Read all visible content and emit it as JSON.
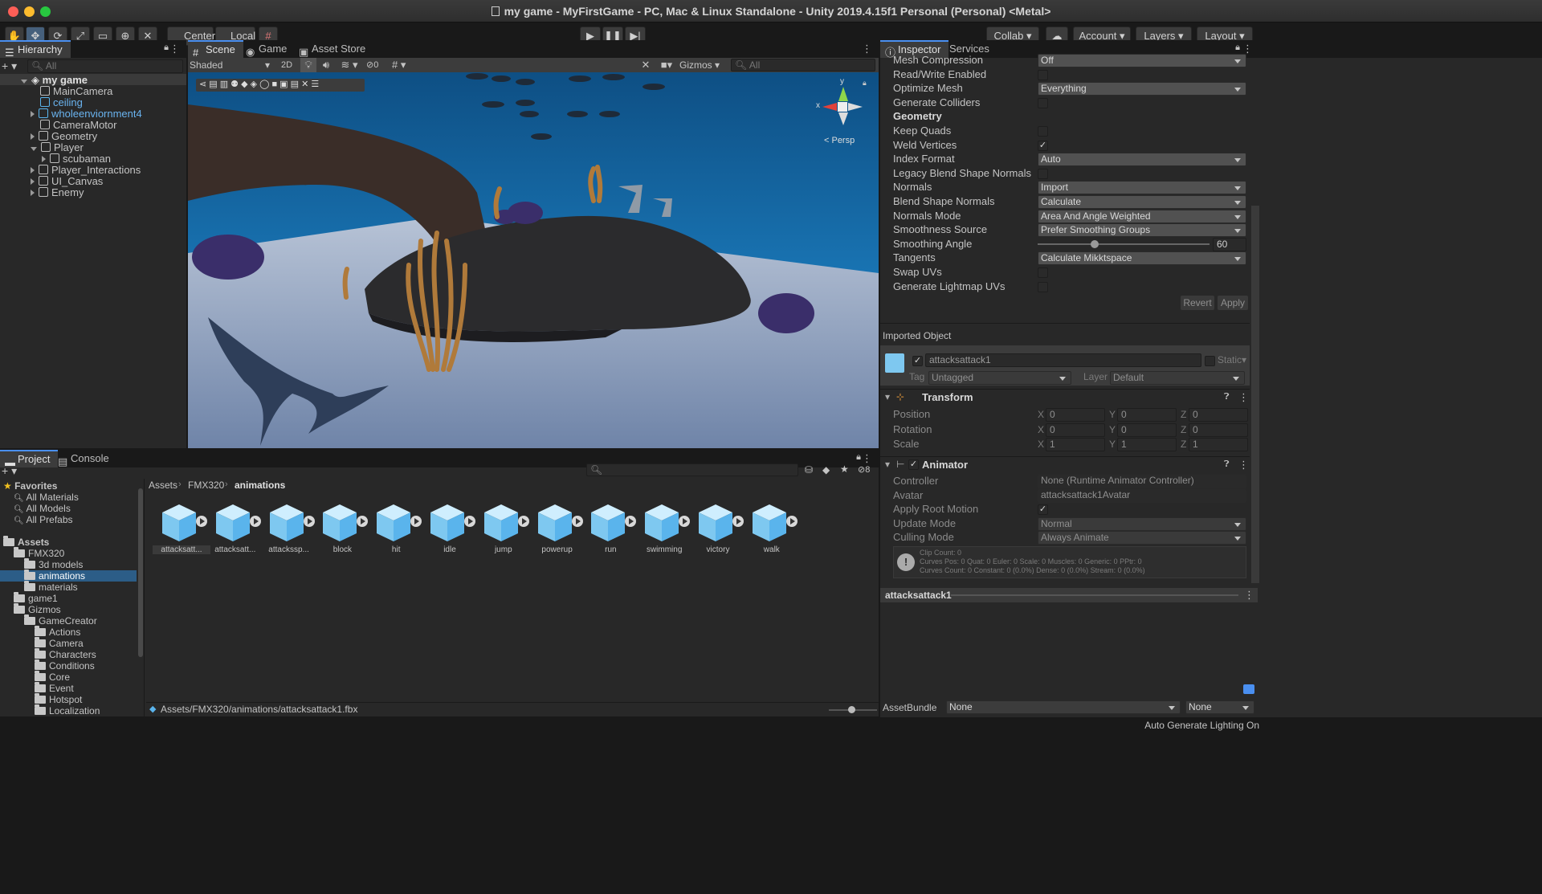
{
  "window": {
    "title": "my game - MyFirstGame - PC, Mac & Linux Standalone - Unity 2019.4.15f1 Personal (Personal) <Metal>"
  },
  "toolbar": {
    "center": "Center",
    "local": "Local",
    "collab": "Collab",
    "account": "Account",
    "layers": "Layers",
    "layout": "Layout"
  },
  "hierarchy": {
    "tab": "Hierarchy",
    "search": "All",
    "scene": "my game",
    "items": [
      "MainCamera",
      "ceiling",
      "wholeenviornment4",
      "CameraMotor",
      "Geometry",
      "Player",
      "scubaman",
      "Player_Interactions",
      "UI_Canvas",
      "Enemy"
    ]
  },
  "scene": {
    "tabs": [
      "Scene",
      "Game",
      "Asset Store"
    ],
    "shading": "Shaded",
    "mode2d": "2D",
    "gizmos": "Gizmos",
    "search": "All",
    "persp": "< Persp",
    "hidden_count": "0",
    "axis_x": "x",
    "axis_y": "y"
  },
  "project": {
    "tabs": [
      "Project",
      "Console"
    ],
    "hidden_count": "8",
    "tree": [
      {
        "label": "Favorites",
        "level": 0,
        "kind": "fav"
      },
      {
        "label": "All Materials",
        "level": 1,
        "kind": "search"
      },
      {
        "label": "All Models",
        "level": 1,
        "kind": "search"
      },
      {
        "label": "All Prefabs",
        "level": 1,
        "kind": "search"
      },
      {
        "label": "Assets",
        "level": 0,
        "kind": "folder"
      },
      {
        "label": "FMX320",
        "level": 1,
        "kind": "folder"
      },
      {
        "label": "3d models",
        "level": 2,
        "kind": "folder"
      },
      {
        "label": "animations",
        "level": 2,
        "kind": "folder"
      },
      {
        "label": "materials",
        "level": 2,
        "kind": "folder"
      },
      {
        "label": "game1",
        "level": 1,
        "kind": "folder"
      },
      {
        "label": "Gizmos",
        "level": 1,
        "kind": "folder"
      },
      {
        "label": "GameCreator",
        "level": 2,
        "kind": "folder"
      },
      {
        "label": "Actions",
        "level": 3,
        "kind": "folder"
      },
      {
        "label": "Camera",
        "level": 3,
        "kind": "folder"
      },
      {
        "label": "Characters",
        "level": 3,
        "kind": "folder"
      },
      {
        "label": "Conditions",
        "level": 3,
        "kind": "folder"
      },
      {
        "label": "Core",
        "level": 3,
        "kind": "folder"
      },
      {
        "label": "Event",
        "level": 3,
        "kind": "folder"
      },
      {
        "label": "Hotspot",
        "level": 3,
        "kind": "folder"
      },
      {
        "label": "Localization",
        "level": 3,
        "kind": "folder"
      }
    ],
    "breadcrumb": [
      "Assets",
      "FMX320",
      "animations"
    ],
    "assets": [
      "attacksatt...",
      "attacksatt...",
      "attackssp...",
      "block",
      "hit",
      "idle",
      "jump",
      "powerup",
      "run",
      "swimming",
      "victory",
      "walk"
    ],
    "footer_path": "Assets/FMX320/animations/attacksattack1.fbx"
  },
  "inspector": {
    "tabs": [
      "Inspector",
      "Services"
    ],
    "rows": [
      {
        "label": "Mesh Compression",
        "type": "dd",
        "value": "Off"
      },
      {
        "label": "Read/Write Enabled",
        "type": "chk",
        "value": ""
      },
      {
        "label": "Optimize Mesh",
        "type": "dd",
        "value": "Everything"
      },
      {
        "label": "Generate Colliders",
        "type": "chk",
        "value": ""
      },
      {
        "label": "Geometry",
        "type": "hdr",
        "value": ""
      },
      {
        "label": "Keep Quads",
        "type": "chk",
        "value": ""
      },
      {
        "label": "Weld Vertices",
        "type": "chk",
        "value": "✓"
      },
      {
        "label": "Index Format",
        "type": "dd",
        "value": "Auto"
      },
      {
        "label": "Legacy Blend Shape Normals",
        "type": "chk",
        "value": ""
      },
      {
        "label": "Normals",
        "type": "dd",
        "value": "Import"
      },
      {
        "label": "Blend Shape Normals",
        "type": "dd",
        "value": "Calculate"
      },
      {
        "label": "Normals Mode",
        "type": "dd",
        "value": "Area And Angle Weighted"
      },
      {
        "label": "Smoothness Source",
        "type": "dd",
        "value": "Prefer Smoothing Groups"
      },
      {
        "label": "Smoothing Angle",
        "type": "slider",
        "value": "60"
      },
      {
        "label": "Tangents",
        "type": "dd",
        "value": "Calculate Mikktspace"
      },
      {
        "label": "Swap UVs",
        "type": "chk",
        "value": ""
      },
      {
        "label": "Generate Lightmap UVs",
        "type": "chk",
        "value": ""
      }
    ],
    "slider_fraction": 0.33,
    "revert": "Revert",
    "apply": "Apply",
    "imported_object": "Imported Object",
    "object_name": "attacksattack1",
    "static": "Static",
    "tag_label": "Tag",
    "tag_value": "Untagged",
    "layer_label": "Layer",
    "layer_value": "Default",
    "transform": {
      "title": "Transform",
      "position": "Position",
      "rotation": "Rotation",
      "scale": "Scale",
      "pos": [
        "0",
        "0",
        "0"
      ],
      "rot": [
        "0",
        "0",
        "0"
      ],
      "scl": [
        "1",
        "1",
        "1"
      ],
      "axes": [
        "X",
        "Y",
        "Z"
      ]
    },
    "animator": {
      "title": "Animator",
      "rows": [
        {
          "label": "Controller",
          "value": "None (Runtime Animator Controller)"
        },
        {
          "label": "Avatar",
          "value": "attacksattack1Avatar"
        },
        {
          "label": "Apply Root Motion",
          "value": "✓"
        },
        {
          "label": "Update Mode",
          "value": "Normal"
        },
        {
          "label": "Culling Mode",
          "value": "Always Animate"
        }
      ],
      "info": [
        "Clip Count: 0",
        "Curves Pos: 0 Quat: 0 Euler: 0 Scale: 0 Muscles: 0 Generic: 0 PPtr: 0",
        "Curves Count: 0 Constant: 0 (0.0%) Dense: 0 (0.0%) Stream: 0 (0.0%)"
      ]
    },
    "preview_title": "attacksattack1",
    "assetbundle_label": "AssetBundle",
    "assetbundle_value": "None",
    "assetbundle_variant": "None"
  },
  "status": {
    "text": "Auto Generate Lighting On"
  }
}
